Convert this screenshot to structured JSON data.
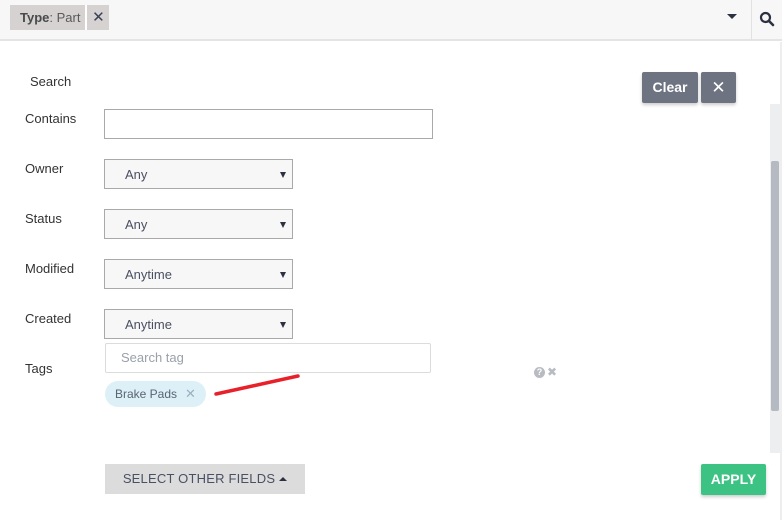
{
  "topbar": {
    "filter_chip": {
      "key": "Type",
      "separator": ": ",
      "value": "Part",
      "remove_icon": "close-icon"
    },
    "dropdown_icon": "caret-down-icon",
    "search_icon": "search-icon"
  },
  "panel": {
    "section_title": "Search",
    "buttons": {
      "clear": "Clear",
      "close": "✕",
      "select_other_fields": "SELECT OTHER FIELDS",
      "apply": "APPLY"
    },
    "fields": {
      "contains": {
        "label": "Contains",
        "value": "",
        "placeholder": ""
      },
      "owner": {
        "label": "Owner",
        "value": "Any"
      },
      "status": {
        "label": "Status",
        "value": "Any"
      },
      "modified": {
        "label": "Modified",
        "value": "Anytime"
      },
      "created": {
        "label": "Created",
        "value": "Anytime"
      },
      "tags": {
        "label": "Tags",
        "placeholder": "Search tag",
        "selected": [
          "Brake Pads"
        ],
        "help_icon": "?",
        "remove_icon": "✖"
      }
    }
  },
  "colors": {
    "apply": "#3cc383",
    "clear": "#6d7380",
    "tag_pill": "#ddf0f8",
    "annotation": "#e8202a"
  }
}
